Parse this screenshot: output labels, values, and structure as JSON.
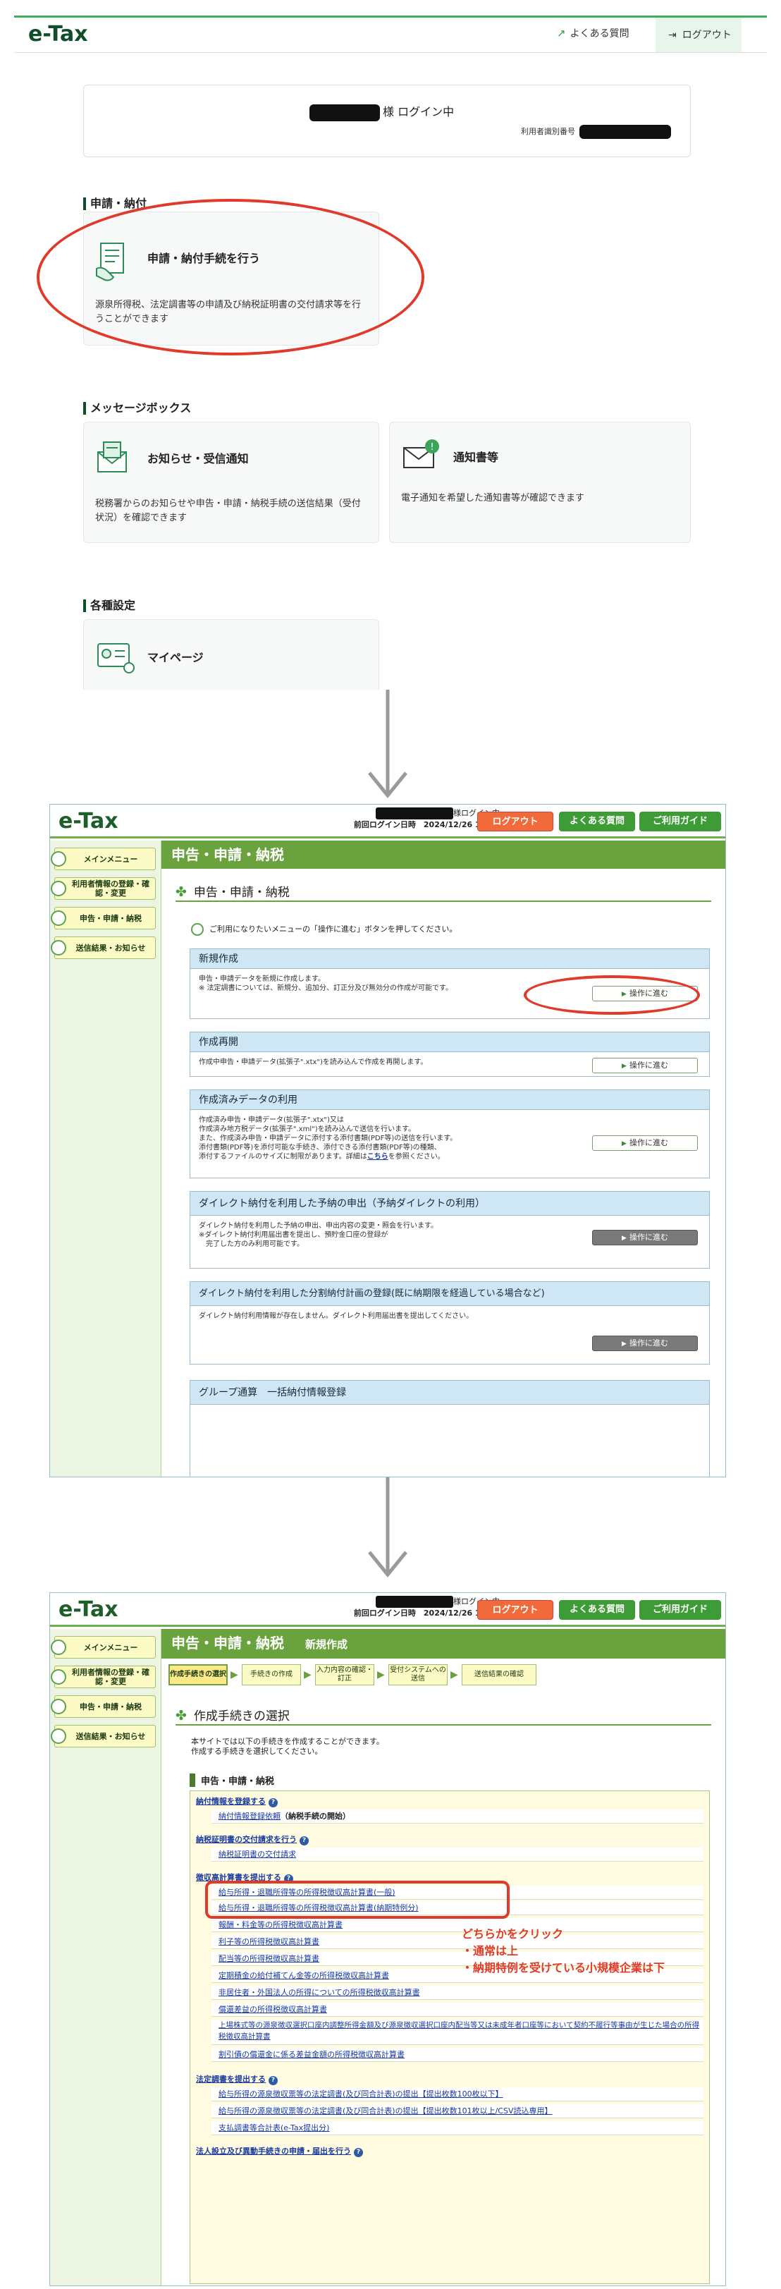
{
  "portal": {
    "logo": "e-Tax",
    "header_links": {
      "faq": "よくある質問",
      "logout": "ログアウト"
    },
    "user": {
      "login_suffix": "様 ログイン中",
      "id_label": "利用者識別番号"
    },
    "sections": [
      {
        "title": "申請・納付",
        "cards": [
          {
            "title": "申請・納付手続を行う",
            "desc": "源泉所得税、法定調書等の申請及び納税証明書の交付請求等を行うことができます",
            "icon": "document-icon"
          }
        ]
      },
      {
        "title": "メッセージボックス",
        "cards": [
          {
            "title": "お知らせ・受信通知",
            "desc": "税務署からのお知らせや申告・申請・納税手続の送信結果（受付状況）を確認できます",
            "icon": "mail-icon"
          },
          {
            "title": "通知書等",
            "desc": "電子通知を希望した通知書等が確認できます",
            "icon": "envelope-icon"
          }
        ]
      },
      {
        "title": "各種設定",
        "cards": [
          {
            "title": "マイページ",
            "desc": "",
            "icon": "profile-icon"
          }
        ]
      }
    ]
  },
  "old1": {
    "logo": "e-Tax",
    "login_suffix": "様ログイン中",
    "last_login": "前回ログイン日時　2024/12/26 19:57",
    "buttons": {
      "logout": "ログアウト",
      "faq": "よくある質問",
      "guide": "ご利用ガイド"
    },
    "side": [
      "メインメニュー",
      "利用者情報の登録・確認・変更",
      "申告・申請・納税",
      "送信結果・お知らせ"
    ],
    "header": "申告・申請・納税",
    "subtitle": "申告・申請・納税",
    "hint": "ご利用になりたいメニューの「操作に進む」ボタンを押してください。",
    "op_button": "操作に進む",
    "boxes": [
      {
        "title": "新規作成",
        "body": "申告・申請データを新規に作成します。\n※ 法定調書については、新規分、追加分、訂正分及び無効分の作成が可能です。"
      },
      {
        "title": "作成再開",
        "body": "作成中申告・申請データ(拡張子\".xtx\")を読み込んで作成を再開します。"
      },
      {
        "title": "作成済みデータの利用",
        "body": "作成済み申告・申請データ(拡張子\".xtx\")又は\n作成済み地方税データ(拡張子\".xml\")を読み込んで送信を行います。\nまた、作成済み申告・申請データに添付する添付書類(PDF等)の送信を行います。\n添付書類(PDF等)を添付可能な手続き、添付できる添付書類(PDF等)の種類、\n添付するファイルのサイズに制限があります。詳細は",
        "link": "こちら",
        "body_tail": "を参照ください。"
      },
      {
        "title": "ダイレクト納付を利用した予納の申出（予納ダイレクトの利用）",
        "body": "ダイレクト納付を利用した予納の申出、申出内容の変更・照会を行います。\n※ダイレクト納付利用届出書を提出し、預貯金口座の登録が\n　完了した方のみ利用可能です。"
      },
      {
        "title": "ダイレクト納付を利用した分割納付計画の登録(既に納期限を経過している場合など)",
        "body": "ダイレクト納付利用情報が存在しません。ダイレクト利用届出書を提出してください。"
      },
      {
        "title": "グループ通算　一括納付情報登録",
        "body": ""
      }
    ]
  },
  "old2": {
    "logo": "e-Tax",
    "login_suffix": "様ログイン中",
    "last_login": "前回ログイン日時　2024/12/26 19:58",
    "buttons": {
      "logout": "ログアウト",
      "faq": "よくある質問",
      "guide": "ご利用ガイド"
    },
    "side": [
      "メインメニュー",
      "利用者情報の登録・確認・変更",
      "申告・申請・納税",
      "送信結果・お知らせ"
    ],
    "header": "申告・申請・納税",
    "header_sub": "新規作成",
    "steps": [
      "作成手続きの選択",
      "手続きの作成",
      "入力内容の確認・訂正",
      "受付システムへの送信",
      "送信結果の確認"
    ],
    "subtitle": "作成手続きの選択",
    "intro": "本サイトでは以下の手続きを作成することができます。\n作成する手続きを選択してください。",
    "section": "申告・申請・納税",
    "groups": [
      {
        "head": "納付情報を登録する",
        "rows": [
          {
            "text": "納付情報登録依頼",
            "note": "（納税手続の開始）"
          }
        ]
      },
      {
        "head": "納税証明書の交付請求を行う",
        "rows": [
          {
            "text": "納税証明書の交付請求"
          }
        ]
      },
      {
        "head": "徴収高計算書を提出する",
        "rows": [
          {
            "text": "給与所得・退職所得等の所得税徴収高計算書(一般)"
          },
          {
            "text": "給与所得・退職所得等の所得税徴収高計算書(納期特例分)"
          },
          {
            "text": "報酬・料金等の所得税徴収高計算書"
          },
          {
            "text": "利子等の所得税徴収高計算書"
          },
          {
            "text": "配当等の所得税徴収高計算書"
          },
          {
            "text": "定期積金の給付補てん金等の所得税徴収高計算書"
          },
          {
            "text": "非居住者・外国法人の所得についての所得税徴収高計算書"
          },
          {
            "text": "償還差益の所得税徴収高計算書"
          },
          {
            "text": "上場株式等の源泉徴収選択口座内調整所得金額及び源泉徴収選択口座内配当等又は未成年者口座等において契約不履行等事由が生じた場合の所得税徴収高計算書"
          },
          {
            "text": "割引債の償還金に係る差益金額の所得税徴収高計算書"
          }
        ]
      },
      {
        "head": "法定調書を提出する",
        "rows": [
          {
            "text": "給与所得の源泉徴収票等の法定調書(及び同合計表)の提出【提出枚数100枚以下】"
          },
          {
            "text": "給与所得の源泉徴収票等の法定調書(及び同合計表)の提出【提出枚数101枚以上/CSV読込専用】"
          },
          {
            "text": "支払調書等合計表(e-Tax提出分)"
          }
        ]
      },
      {
        "head": "法人設立及び異動手続きの申請・届出を行う",
        "rows": []
      }
    ],
    "annotation": [
      "どちらかをクリック",
      "・通常は上",
      "・納期特例を受けている小規模企業は下"
    ]
  },
  "colors": {
    "accent_green": "#6aa33e",
    "portal_green": "#0f4d2b",
    "annotation_red": "#e03a2a",
    "logout_orange": "#f06a3a"
  }
}
